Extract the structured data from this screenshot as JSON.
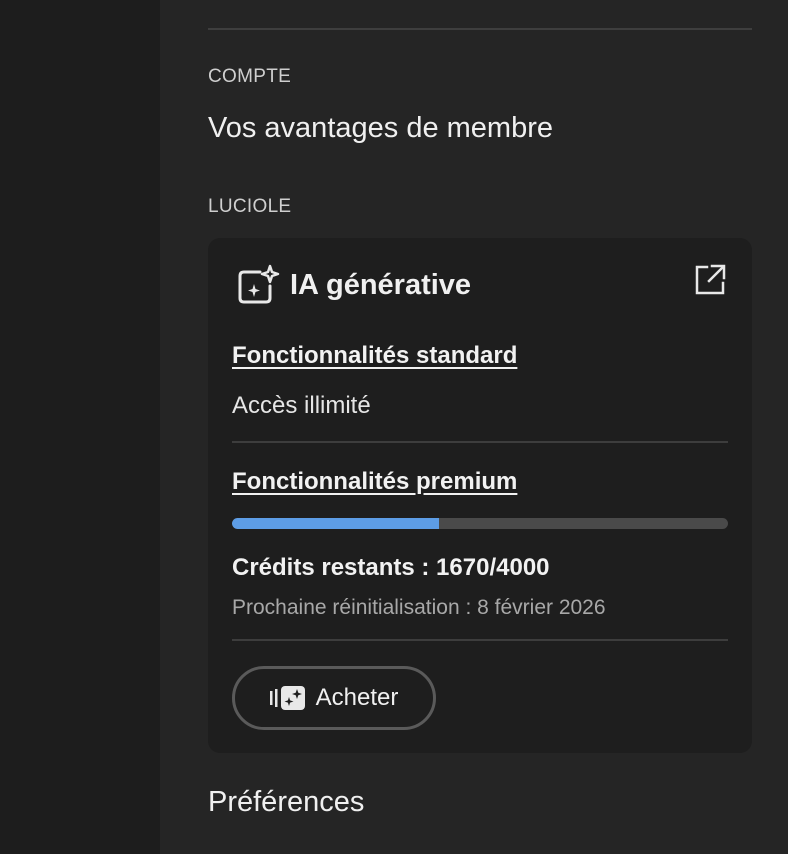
{
  "account_section": {
    "label": "COMPTE",
    "heading": "Vos avantages de membre"
  },
  "firefly_section": {
    "label": "LUCIOLE",
    "card": {
      "title": "IA générative",
      "title_icon": "generative-ai-sparkle-icon",
      "external_icon": "external-link-icon",
      "standard": {
        "heading": "Fonctionnalités standard",
        "value": "Accès illimité"
      },
      "premium": {
        "heading": "Fonctionnalités premium",
        "credits_used_fraction": 0.4175,
        "credits_text": "Crédits restants : 1670/4000",
        "reset_text": "Prochaine réinitialisation : 8 février 2026"
      },
      "buy_button": {
        "label": "Acheter",
        "icon": "buy-credits-icon"
      }
    }
  },
  "preferences_heading": "Préférences",
  "colors": {
    "panel_background": "#252525",
    "card_background": "#1e1e1e",
    "progress_fill": "#5d9de6",
    "progress_track": "#4a4a4a"
  }
}
